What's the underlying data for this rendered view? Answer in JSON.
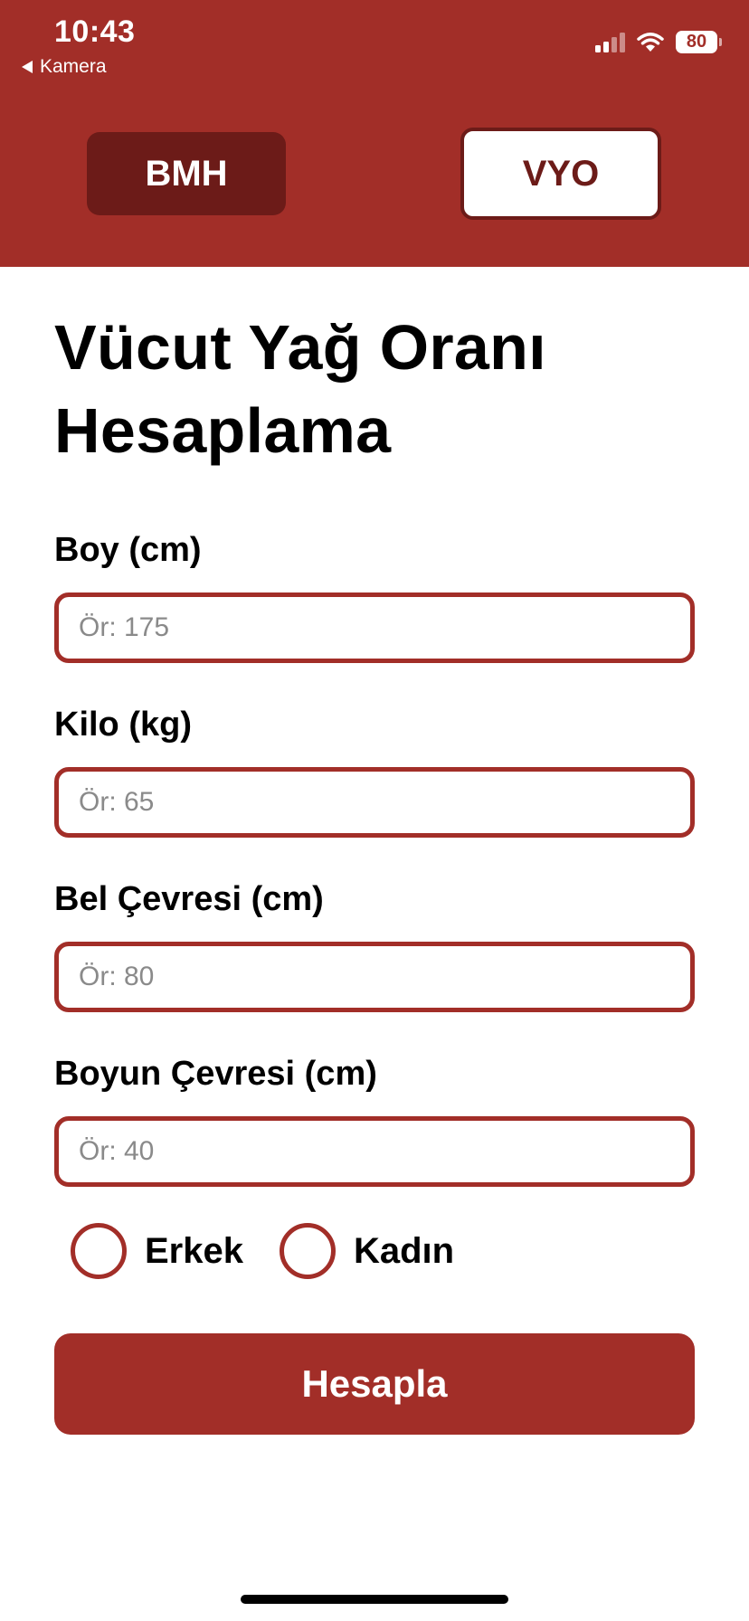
{
  "status_bar": {
    "time": "10:43",
    "back_label": "Kamera",
    "battery": "80"
  },
  "tabs": [
    {
      "label": "BMH",
      "active": false
    },
    {
      "label": "VYO",
      "active": true
    }
  ],
  "page": {
    "title_line1": "Vücut Yağ Oranı",
    "title_line2": "Hesaplama"
  },
  "form": {
    "height_label": "Boy (cm)",
    "height_placeholder": "Ör: 175",
    "weight_label": "Kilo (kg)",
    "weight_placeholder": "Ör: 65",
    "waist_label": "Bel Çevresi (cm)",
    "waist_placeholder": "Ör: 80",
    "neck_label": "Boyun Çevresi (cm)",
    "neck_placeholder": "Ör: 40",
    "gender_options": [
      "Erkek",
      "Kadın"
    ],
    "submit_label": "Hesapla"
  },
  "colors": {
    "primary": "#a22e28",
    "primary_dark": "#6c1b18",
    "background": "#ffffff"
  }
}
